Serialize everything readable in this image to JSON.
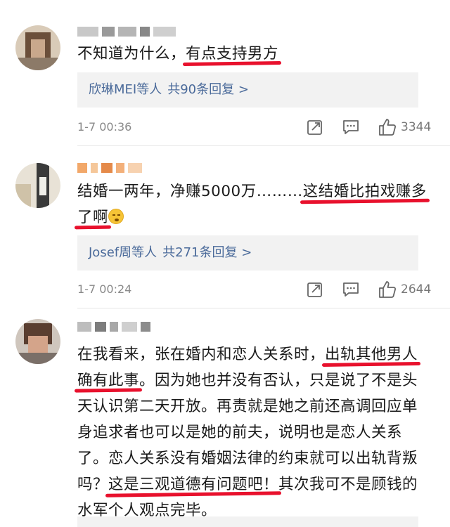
{
  "comments": [
    {
      "text_plain": "不知道为什么，",
      "text_hl": "有点支持男方",
      "reply": {
        "users": "欣琳MEI等人",
        "count": "共90条回复 >"
      },
      "time": "1-7 00:36",
      "likes": "3344"
    },
    {
      "text_plain": "结婚一两年，净赚5000万………",
      "text_hl1": "这结婚比拍戏赚多",
      "text_hl2": "了啊",
      "reply": {
        "users": "Josef周等人",
        "count": "共271条回复 >"
      },
      "time": "1-7 00:24",
      "likes": "2644"
    },
    {
      "line1_plain": "在我看来，张在婚内和恋人关系时，",
      "line1_hl": "出轨其他男人",
      "line2_hl": "确有此事",
      "line2_plain": "。因为她也并没有否认，只是说了不是头",
      "line3": "天认识第二天开放。再责就是她之前还高调回应单",
      "line4": "身追求者也可以是她的前夫，说明也是恋人关系",
      "line5": "了。恋人关系没有婚姻法律的约束就可以出轨背叛",
      "line6_plain1": "吗？",
      "line6_hl": "这是三观道德有问题吧！",
      "line6_plain2": "其次我可不是顾钱的",
      "line7": "水军个人观点完毕。"
    }
  ],
  "icons": [
    "share-icon",
    "comment-icon",
    "like-icon",
    "emoji-icon"
  ],
  "colors": {
    "highlight": "#e8112d",
    "link": "#4a6a9a",
    "reply_bg": "#f2f2f2"
  }
}
